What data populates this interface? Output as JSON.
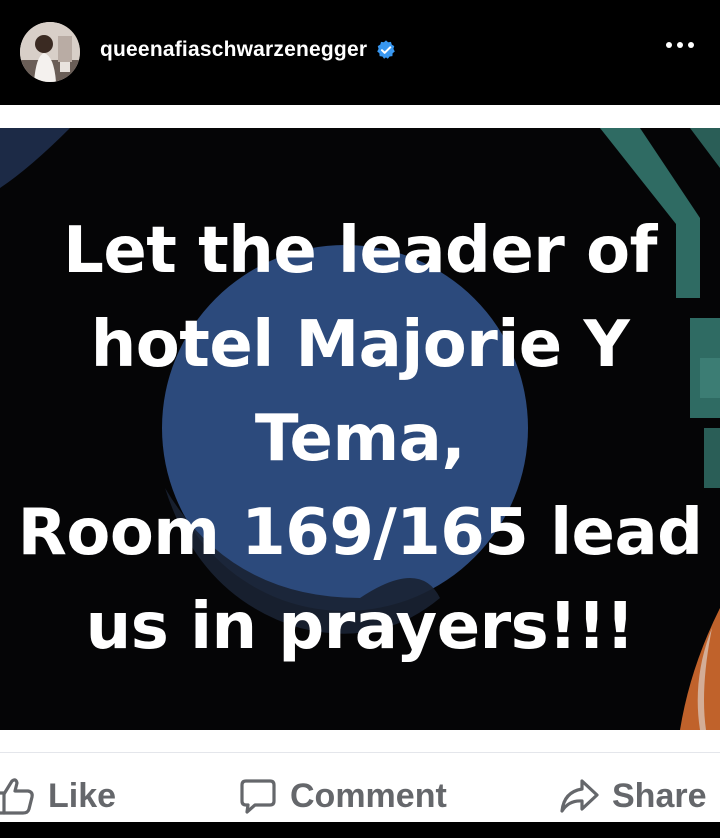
{
  "post": {
    "username": "queenafiaschwarzenegger",
    "verified_icon": "verified-badge-icon",
    "image_text_lines": [
      "Let the leader of",
      "hotel Majorie Y",
      "Tema,",
      "Room 169/165 lead",
      "us in prayers!!!"
    ]
  },
  "actions": {
    "like_label": "Like",
    "comment_label": "Comment",
    "share_label": "Share"
  },
  "colors": {
    "verified_blue": "#3897f0",
    "action_gray": "#65676b",
    "circle_blue": "#2c4a7c",
    "teal_accent": "#2f6b63",
    "orange_accent": "#c0622b"
  }
}
